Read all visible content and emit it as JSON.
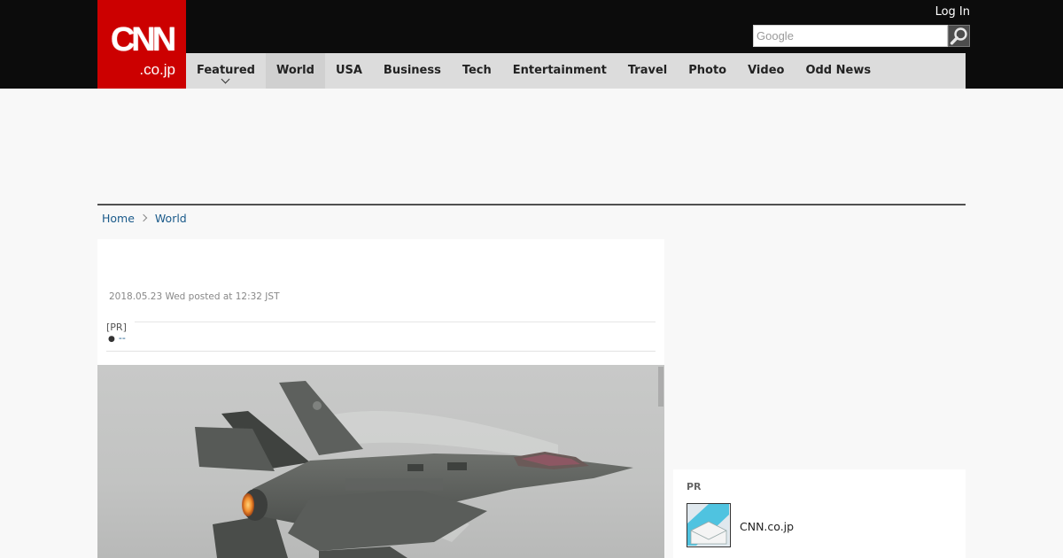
{
  "header": {
    "logo_main": "CNN",
    "logo_sub": ".co.jp",
    "login_label": "Log In",
    "search_placeholder": "Google",
    "search_icon": "magnifier-icon"
  },
  "nav": {
    "items": [
      {
        "label": "Featured",
        "has_dropdown": true
      },
      {
        "label": "World",
        "active": true
      },
      {
        "label": "USA"
      },
      {
        "label": "Business"
      },
      {
        "label": "Tech"
      },
      {
        "label": "Entertainment"
      },
      {
        "label": "Travel"
      },
      {
        "label": "Photo"
      },
      {
        "label": "Video"
      },
      {
        "label": "Odd News"
      }
    ]
  },
  "breadcrumb": {
    "home": "Home",
    "current": "World"
  },
  "article": {
    "posted": "2018.05.23 Wed posted at 12:32 JST",
    "pr_tag": "[PR]",
    "pr_link": "--",
    "photo_alt_icon": "fighter-jet-photo"
  },
  "sidebar_pr": {
    "label": "PR",
    "title": "CNN.co.jp",
    "thumb_icon": "envelope-thumbnail-icon"
  },
  "colors": {
    "brand_red": "#cc0000",
    "topbar": "#0c0c0c",
    "nav_bg": "#dcdcdc",
    "link": "#1a5a8a"
  }
}
